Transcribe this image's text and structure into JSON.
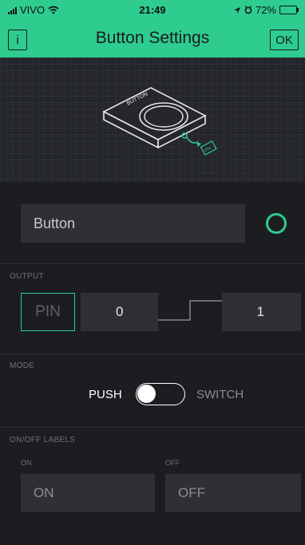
{
  "status_bar": {
    "carrier": "VIVO",
    "time": "21:49",
    "battery": "72%",
    "battery_level": 0.72
  },
  "header": {
    "title": "Button Settings",
    "info_label": "i",
    "ok_label": "OK"
  },
  "preview": {
    "device_label": "BUTTON",
    "pin_tag": "PIN"
  },
  "widget": {
    "name_value": "Button",
    "accent_color": "#2ecc8f"
  },
  "output": {
    "section_label": "OUTPUT",
    "pin_label": "PIN",
    "min_value": "0",
    "max_value": "1"
  },
  "mode": {
    "section_label": "MODE",
    "push_label": "PUSH",
    "switch_label": "SWITCH",
    "selected": "PUSH"
  },
  "labels": {
    "section_label": "ON/OFF LABELS",
    "on_caption": "ON",
    "off_caption": "OFF",
    "on_value": "ON",
    "off_value": "OFF"
  },
  "colors": {
    "accent": "#2ecc8f",
    "background": "#1c1d21",
    "field": "#2f3035"
  }
}
